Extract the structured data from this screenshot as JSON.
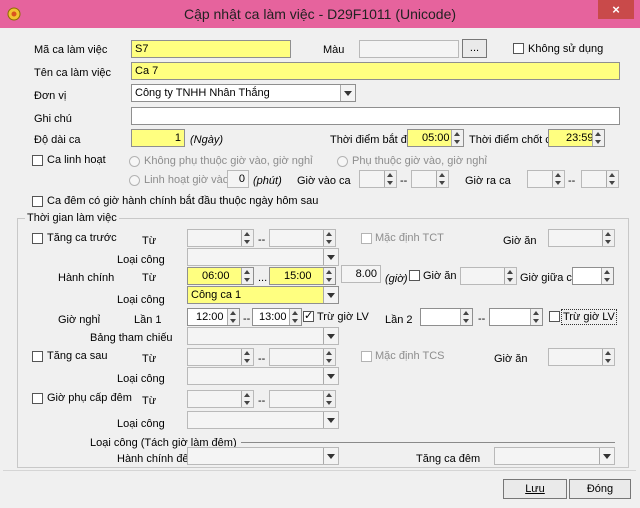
{
  "window": {
    "title": "Cập nhật ca làm việc - D29F1011 (Unicode)",
    "close": "×"
  },
  "general": {
    "shift_code_label": "Mã ca làm việc",
    "shift_code": "S7",
    "color_label": "Màu",
    "color_button": "...",
    "not_used_label": "Không sử dụng",
    "shift_name_label": "Tên ca làm việc",
    "shift_name": "Ca 7",
    "unit_label": "Đơn vị",
    "unit": "Công ty TNHH Nhân Thắng",
    "note_label": "Ghi chú",
    "note": "",
    "length_label": "Độ dài ca",
    "length": "1",
    "length_unit": "(Ngày)",
    "start_label": "Thời điểm bắt đầu",
    "start": "05:00",
    "close_label": "Thời điểm chốt ca",
    "close": "23:59"
  },
  "flex": {
    "label": "Ca linh hoạt",
    "opt_independent": "Không phụ thuộc giờ vào, giờ nghỉ",
    "opt_dependent": "Phụ thuộc giờ vào, giờ nghỉ",
    "opt_flex_in": "Linh hoạt giờ vào ca",
    "flex_in_value": "0",
    "flex_in_unit": "(phút)",
    "time_in_label": "Giờ vào ca",
    "time_out_label": "Giờ ra ca",
    "dash": "--"
  },
  "night_prev_label": "Ca đêm có giờ hành chính bắt đầu thuộc ngày hôm sau",
  "worktime": {
    "group_label": "Thời gian làm việc",
    "before": {
      "label": "Tăng ca trước",
      "from_label": "Từ",
      "dash": "--",
      "default_tct_label": "Mặc định TCT",
      "meal_label": "Giờ ăn",
      "work_type_label": "Loại công"
    },
    "office": {
      "label": "Hành chính",
      "from_label": "Từ",
      "from": "06:00",
      "dash": "...",
      "to": "15:00",
      "hours": "8.00",
      "hours_unit": "(giờ)",
      "meal_label": "Giờ ăn",
      "mid_label": "Giờ giữa ca",
      "work_type_label": "Loại công",
      "work_type": "Công ca 1"
    },
    "break": {
      "label": "Giờ nghỉ",
      "l1_label": "Lần 1",
      "l1_from": "12:00",
      "dash": "--",
      "l1_to": "13:00",
      "l1_deduct_label": "Trừ giờ LV",
      "l2_label": "Lần 2",
      "l2_deduct_label": "Trừ giờ LV",
      "ref_table_label": "Bảng tham chiếu"
    },
    "after": {
      "label": "Tăng ca sau",
      "from_label": "Từ",
      "dash": "--",
      "default_tcs_label": "Mặc định TCS",
      "meal_label": "Giờ ăn",
      "work_type_label": "Loại công"
    },
    "night_allow": {
      "label": "Giờ phụ cấp đêm",
      "from_label": "Từ",
      "dash": "--",
      "work_type_label": "Loại công"
    },
    "split": {
      "label": "Loại công (Tách giờ làm đêm)",
      "office_night_label": "Hành chính đêm",
      "ot_night_label": "Tăng ca đêm"
    }
  },
  "buttons": {
    "save": "Lưu",
    "close": "Đóng"
  },
  "colors": {
    "title_bar": "#e6639d",
    "required_field": "#ffff80"
  }
}
